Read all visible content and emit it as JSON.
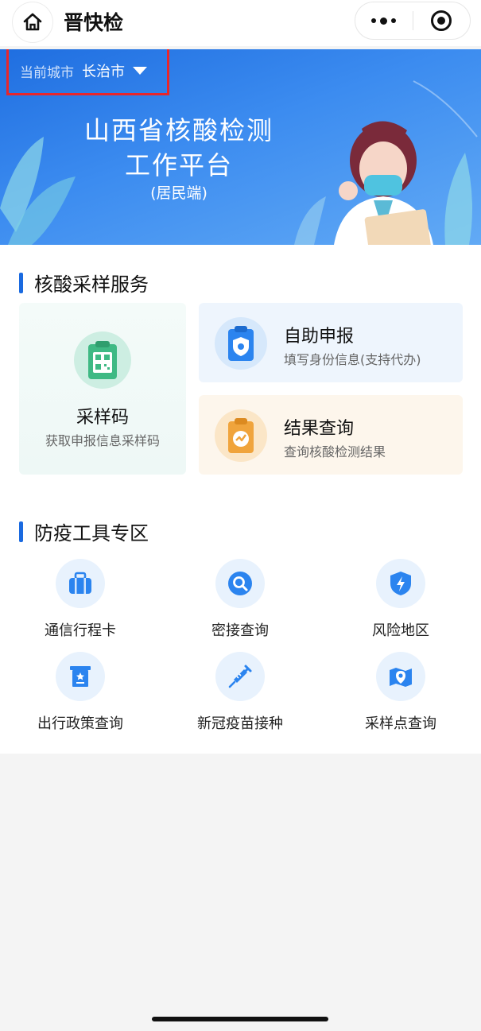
{
  "app": {
    "title": "晋快检"
  },
  "banner": {
    "city_label": "当前城市",
    "city_value": "长治市",
    "title_line1": "山西省核酸检测",
    "title_line2": "工作平台",
    "subtitle": "(居民端)",
    "highlight_color": "#e8262b"
  },
  "sampling": {
    "section_title": "核酸采样服务",
    "qr_card": {
      "title": "采样码",
      "desc": "获取申报信息采样码",
      "icon": "qr-code-clipboard-icon"
    },
    "declare_card": {
      "title": "自助申报",
      "desc": "填写身份信息(支持代办)",
      "icon": "shield-clipboard-icon"
    },
    "result_card": {
      "title": "结果查询",
      "desc": "查询核酸检测结果",
      "icon": "chart-clipboard-icon"
    }
  },
  "tools": {
    "section_title": "防疫工具专区",
    "items": [
      {
        "label": "通信行程卡",
        "icon": "suitcase-icon"
      },
      {
        "label": "密接查询",
        "icon": "search-icon"
      },
      {
        "label": "风险地区",
        "icon": "lightning-shield-icon"
      },
      {
        "label": "出行政策查询",
        "icon": "policy-document-icon"
      },
      {
        "label": "新冠疫苗接种",
        "icon": "syringe-icon"
      },
      {
        "label": "采样点查询",
        "icon": "map-pin-icon"
      }
    ]
  },
  "colors": {
    "accent": "#1a6ae0",
    "banner_start": "#1f6ee0",
    "banner_end": "#62aaf5",
    "icon_blue": "#2b84ef"
  }
}
